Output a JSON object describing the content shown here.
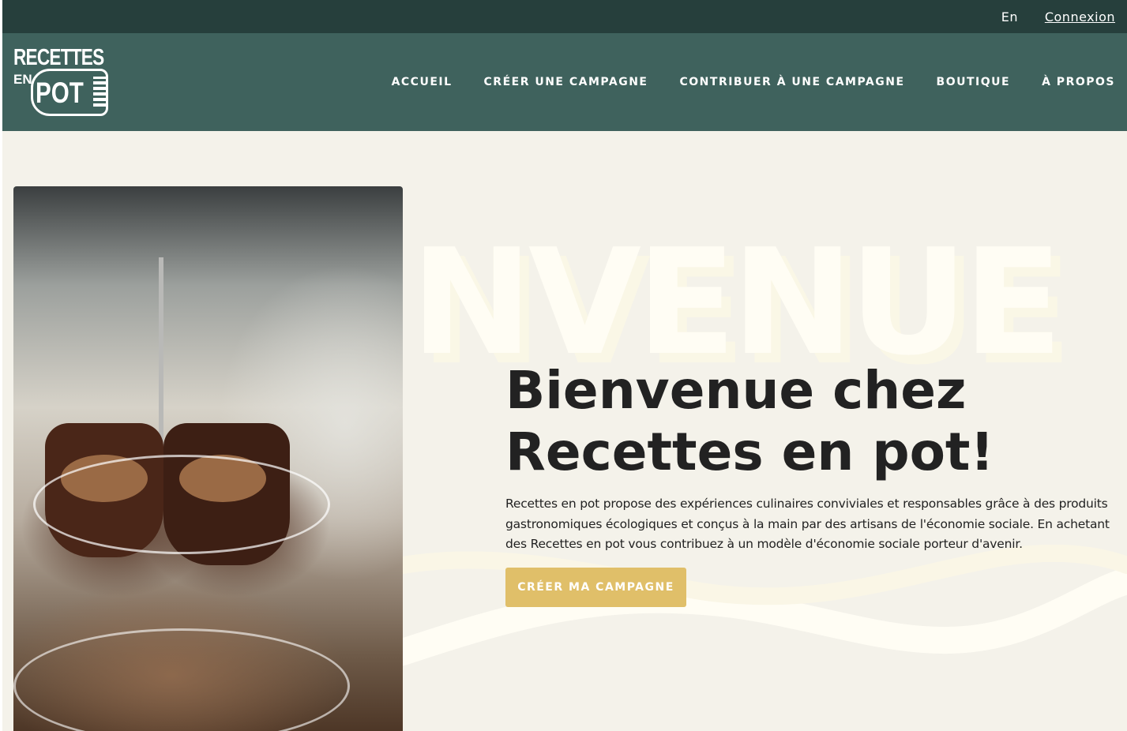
{
  "topbar": {
    "language": "En",
    "login": "Connexion"
  },
  "logo": {
    "line1": "RECETTES",
    "line2_small": "EN",
    "line2_large": "POT"
  },
  "nav": {
    "items": [
      {
        "label": "ACCUEIL"
      },
      {
        "label": "CRÉER UNE CAMPAGNE"
      },
      {
        "label": "CONTRIBUER À UNE CAMPAGNE"
      },
      {
        "label": "BOUTIQUE"
      },
      {
        "label": "À PROPOS"
      }
    ]
  },
  "hero": {
    "watermark": "NVENUE",
    "title_line1": "Bienvenue chez",
    "title_line2": "Recettes en pot!",
    "description": "Recettes en pot propose des expériences culinaires conviviales et responsables grâce à des produits gastronomiques écologiques et conçus à la main par des artisans de l'économie sociale. En achetant des Recettes en pot vous contribuez à un modèle d'économie sociale porteur d'avenir.",
    "cta": "CRÉER MA CAMPAGNE"
  },
  "colors": {
    "topbar": "#263f3c",
    "header": "#3f625d",
    "background": "#f4f2ea",
    "cta": "#e0bf69",
    "text": "#222222"
  }
}
